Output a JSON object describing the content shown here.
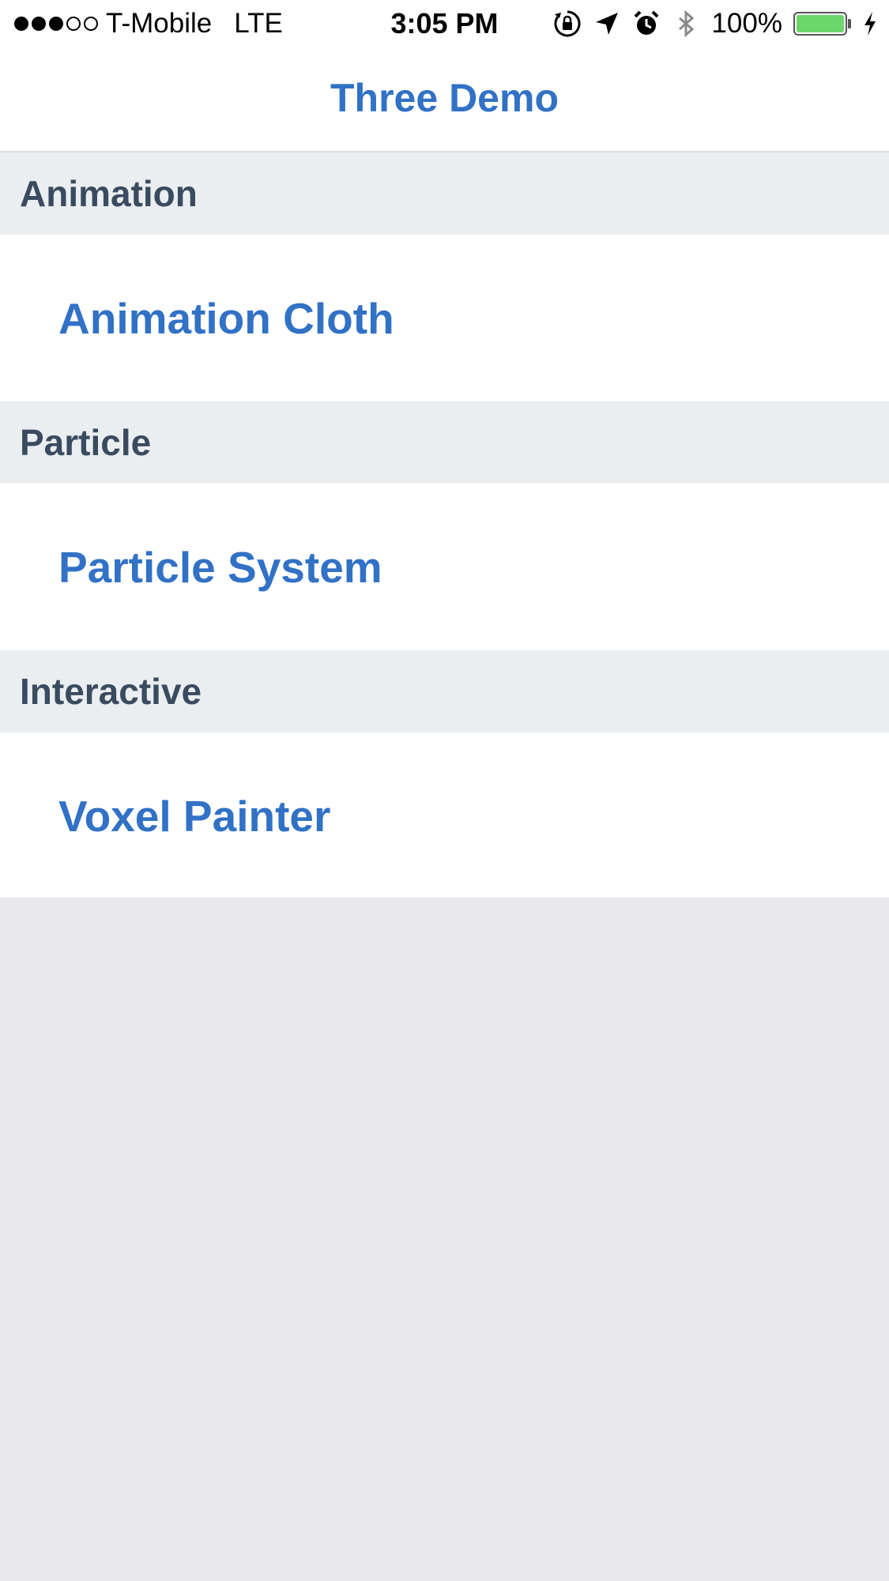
{
  "status_bar": {
    "signal": [
      true,
      true,
      true,
      false,
      false
    ],
    "carrier": "T-Mobile",
    "network": "LTE",
    "time": "3:05 PM",
    "icons": [
      "orientation-lock-icon",
      "location-arrow-icon",
      "alarm-icon",
      "bluetooth-icon"
    ],
    "battery_percent": "100%",
    "battery_level": 1.0,
    "battery_color": "#6cd66c",
    "charging_icon": "charging-bolt-icon"
  },
  "nav": {
    "title": "Three Demo",
    "title_color": "#3171c6"
  },
  "sections": [
    {
      "header": "Animation",
      "items": [
        {
          "label": "Animation Cloth"
        }
      ]
    },
    {
      "header": "Particle",
      "items": [
        {
          "label": "Particle System"
        }
      ]
    },
    {
      "header": "Interactive",
      "items": [
        {
          "label": "Voxel Painter"
        }
      ]
    }
  ],
  "colors": {
    "accent": "#3171c6",
    "section_header_bg": "#ebeef0",
    "section_header_text": "#3a4a60",
    "background": "#e8e8ed"
  }
}
